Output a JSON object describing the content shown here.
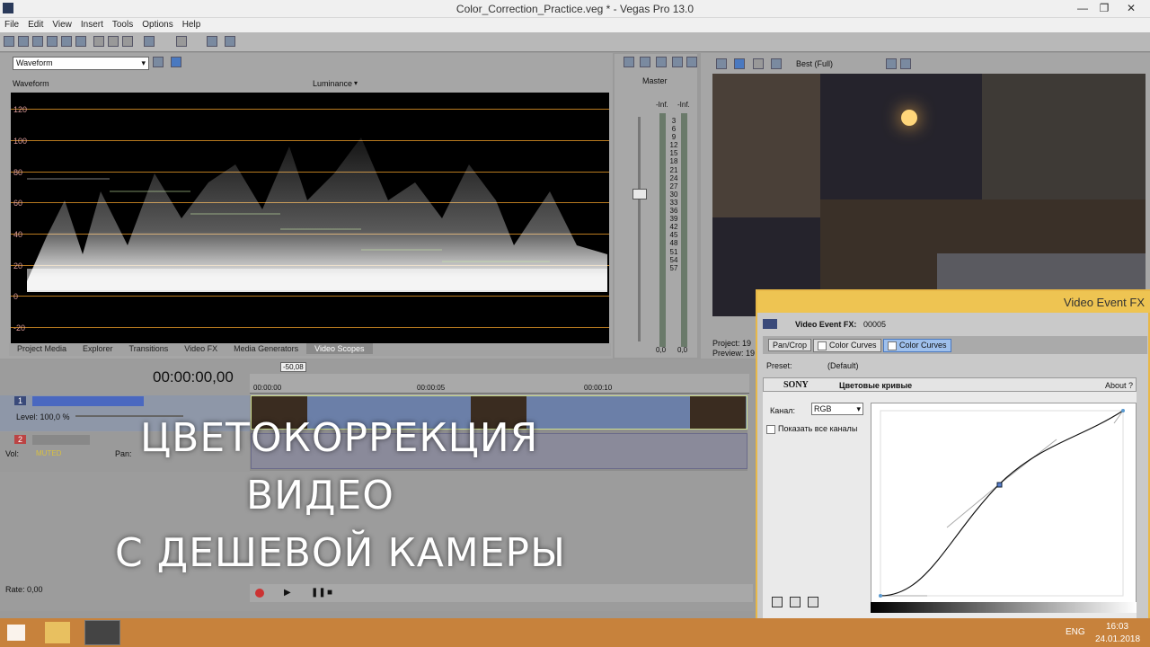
{
  "window": {
    "title": "Color_Correction_Practice.veg * - Vegas Pro 13.0"
  },
  "menu": [
    "File",
    "Edit",
    "View",
    "Insert",
    "Tools",
    "Options",
    "Help"
  ],
  "scopes": {
    "dropdown": "Waveform",
    "header_label": "Waveform",
    "mode_label": "Luminance",
    "y_labels": [
      "120",
      "100",
      "80",
      "60",
      "40",
      "20",
      "0",
      "-20"
    ]
  },
  "window_tabs": [
    "Project Media",
    "Explorer",
    "Transitions",
    "Video FX",
    "Media Generators",
    "Video Scopes"
  ],
  "mixer": {
    "master_label": "Master",
    "peak_left": "-Inf.",
    "peak_right": "-Inf.",
    "scale": [
      "3",
      "6",
      "9",
      "12",
      "15",
      "18",
      "21",
      "24",
      "27",
      "30",
      "33",
      "36",
      "39",
      "42",
      "45",
      "48",
      "51",
      "54",
      "57"
    ],
    "val_left": "0,0",
    "val_right": "0,0"
  },
  "preview": {
    "quality": "Best (Full)",
    "project_label": "Project:",
    "project_val": "19",
    "preview_label": "Preview:",
    "preview_val": "19"
  },
  "timeline": {
    "timecode": "00:00:00,00",
    "marker": "-50,08",
    "ruler": [
      "00:00:00",
      "00:00:05",
      "00:00:10"
    ],
    "level_label": "Level: 100,0 %",
    "vol_label": "Vol:",
    "muted": "MUTED",
    "pan_label": "Pan:",
    "rate": "Rate: 0,00",
    "track1": "1",
    "track2": "2"
  },
  "overlay": {
    "line1": "ЦВЕТОКОРРЕКЦИЯ",
    "line2": "ВИДЕО",
    "line3": "С ДЕШЕВОЙ КАМЕРЫ"
  },
  "fx": {
    "title": "Video Event FX",
    "header": "Video Event FX:",
    "event_id": "00005",
    "chain": [
      "Pan/Crop",
      "Color Curves",
      "Color Curves"
    ],
    "preset_label": "Preset:",
    "preset_value": "(Default)",
    "brand": "SONY",
    "plugin_name": "Цветовые кривые",
    "about": "About",
    "help": "?",
    "channel_label": "Канал:",
    "channel_value": "RGB",
    "show_all": "Показать все каналы"
  },
  "taskbar": {
    "lang": "ENG",
    "time": "16:03",
    "date": "24.01.2018"
  },
  "colors": {
    "accent": "#eec452",
    "taskbar": "#c7823c",
    "clip": "#6b7fa8"
  }
}
